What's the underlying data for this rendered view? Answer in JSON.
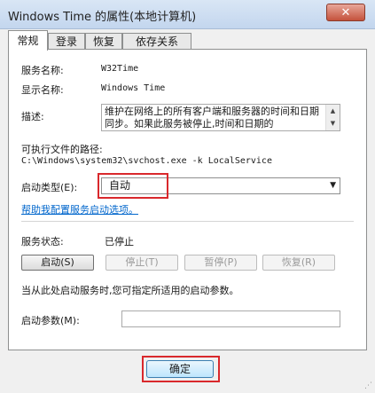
{
  "window": {
    "title": "Windows Time 的属性(本地计算机)",
    "close_glyph": "✕"
  },
  "tabs": [
    {
      "label": "常规",
      "active": true
    },
    {
      "label": "登录",
      "active": false
    },
    {
      "label": "恢复",
      "active": false
    },
    {
      "label": "依存关系",
      "active": false
    }
  ],
  "general": {
    "service_name_label": "服务名称:",
    "service_name_value": "W32Time",
    "display_name_label": "显示名称:",
    "display_name_value": "Windows Time",
    "description_label": "描述:",
    "description_value": "维护在网络上的所有客户端和服务器的时间和日期同步。如果此服务被停止,时间和日期的",
    "exe_path_label": "可执行文件的路径:",
    "exe_path_value": "C:\\Windows\\system32\\svchost.exe -k LocalService",
    "startup_type_label": "启动类型(E):",
    "startup_type_value": "自动",
    "help_link": "帮助我配置服务启动选项。",
    "status_label": "服务状态:",
    "status_value": "已停止",
    "buttons": {
      "start": "启动(S)",
      "stop": "停止(T)",
      "pause": "暂停(P)",
      "resume": "恢复(R)"
    },
    "hint": "当从此处启动服务时,您可指定所适用的启动参数。",
    "start_params_label": "启动参数(M):",
    "start_params_value": ""
  },
  "footer": {
    "ok_label": "确定"
  },
  "colors": {
    "highlight_box": "#d9282c",
    "link": "#0066cc"
  }
}
